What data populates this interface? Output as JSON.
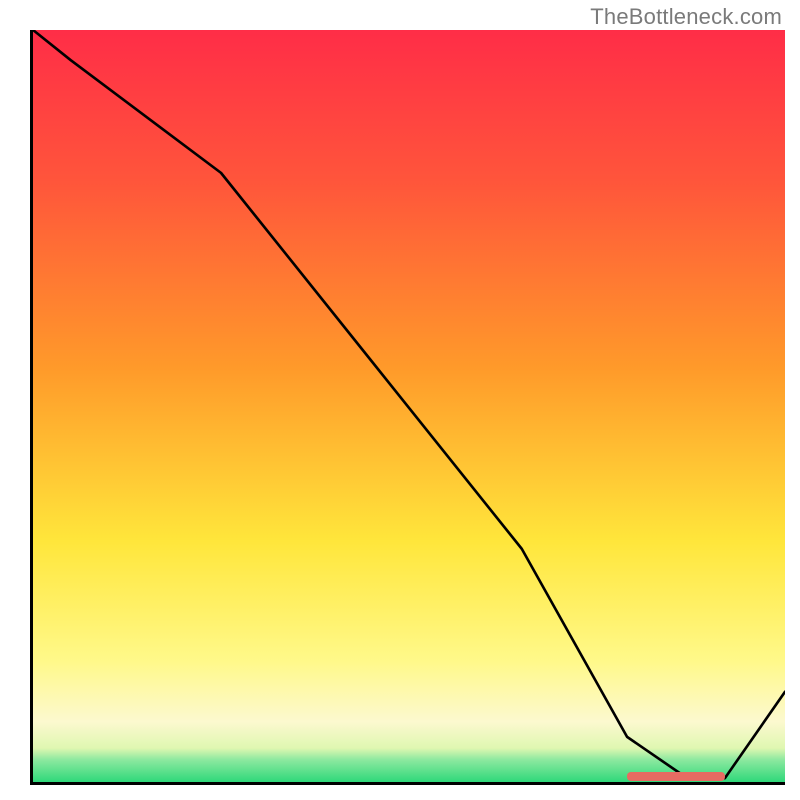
{
  "attribution": "TheBottleneck.com",
  "chart_data": {
    "type": "line",
    "title": "",
    "xlabel": "",
    "ylabel": "",
    "xlim": [
      0,
      100
    ],
    "ylim": [
      0,
      100
    ],
    "x": [
      0,
      5,
      25,
      45,
      65,
      79,
      87,
      92,
      100
    ],
    "values": [
      100,
      96,
      81,
      56,
      31,
      6,
      0.5,
      0.5,
      12
    ],
    "optimal_range_x": [
      79,
      92
    ],
    "background": {
      "top": "#ff2d47",
      "mid1": "#ff9a2a",
      "mid2": "#ffe63b",
      "mid3": "#fcf9cf",
      "bottom": "#2fd87a"
    }
  },
  "marker": {
    "left_pct": 79,
    "width_pct": 13,
    "color": "#e76b62"
  }
}
